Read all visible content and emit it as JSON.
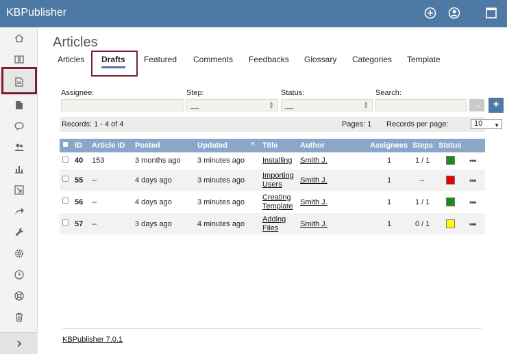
{
  "app": {
    "title": "KBPublisher",
    "colors": {
      "topbar": "#4f79a5",
      "highlight": "#7a1f2b",
      "status_green": "#1a8a1a",
      "status_red": "#e60000",
      "status_yellow": "#ffff00"
    }
  },
  "topbar": {
    "icons": [
      "plus-circle-icon",
      "user-circle-icon",
      "window-icon"
    ]
  },
  "sidebar": {
    "items": [
      "home-icon",
      "book-icon",
      "document-icon",
      "file-icon",
      "chat-icon",
      "users-icon",
      "chart-icon",
      "import-icon",
      "share-icon",
      "wrench-icon",
      "gear-icon",
      "clock-icon",
      "lifebuoy-icon",
      "trash-icon"
    ],
    "active_index": 2,
    "expand_icon": "chevron-right-icon"
  },
  "page": {
    "title": "Articles"
  },
  "tabs": [
    {
      "label": "Articles"
    },
    {
      "label": "Drafts"
    },
    {
      "label": "Featured"
    },
    {
      "label": "Comments"
    },
    {
      "label": "Feedbacks"
    },
    {
      "label": "Glossary"
    },
    {
      "label": "Categories"
    },
    {
      "label": "Template"
    }
  ],
  "filters": {
    "assignee_label": "Assignee:",
    "step_label": "Step:",
    "step_value": "__",
    "status_label": "Status:",
    "status_value": "__",
    "search_label": "Search:",
    "go_button": "→",
    "add_button": "+"
  },
  "records": {
    "summary": "Records: 1 - 4 of 4",
    "pages": "Pages: 1",
    "per_page_label": "Records per page:",
    "per_page_value": "10"
  },
  "table": {
    "headers": {
      "id": "ID",
      "article_id": "Article ID",
      "posted": "Posted",
      "updated": "Updated",
      "title": "Title",
      "author": "Author",
      "assignees": "Assignees",
      "steps": "Steps",
      "status": "Status"
    },
    "rows": [
      {
        "id": "40",
        "article_id": "153",
        "posted": "3 months ago",
        "updated": "3 minutes ago",
        "title_1": "Installing",
        "title_2": "",
        "author": "Smith J.",
        "assignees": "1",
        "steps": "1 / 1",
        "status": "green",
        "menu": "•••"
      },
      {
        "id": "55",
        "article_id": "--",
        "posted": "4 days ago",
        "updated": "3 minutes ago",
        "title_1": "Importing",
        "title_2": "Users",
        "author": "Smith J.",
        "assignees": "1",
        "steps": "--",
        "status": "red",
        "menu": "•••"
      },
      {
        "id": "56",
        "article_id": "--",
        "posted": "4 days ago",
        "updated": "3 minutes ago",
        "title_1": "Creating",
        "title_2": "Template",
        "author": "Smith J.",
        "assignees": "1",
        "steps": "1 / 1",
        "status": "green",
        "menu": "•••"
      },
      {
        "id": "57",
        "article_id": "--",
        "posted": "3 days ago",
        "updated": "4 minutes ago",
        "title_1": "Adding",
        "title_2": "Files",
        "author": "Smith J.",
        "assignees": "1",
        "steps": "0 / 1",
        "status": "yellow",
        "menu": "•••"
      }
    ]
  },
  "footer": {
    "version_link": "KBPublisher 7.0.1"
  }
}
